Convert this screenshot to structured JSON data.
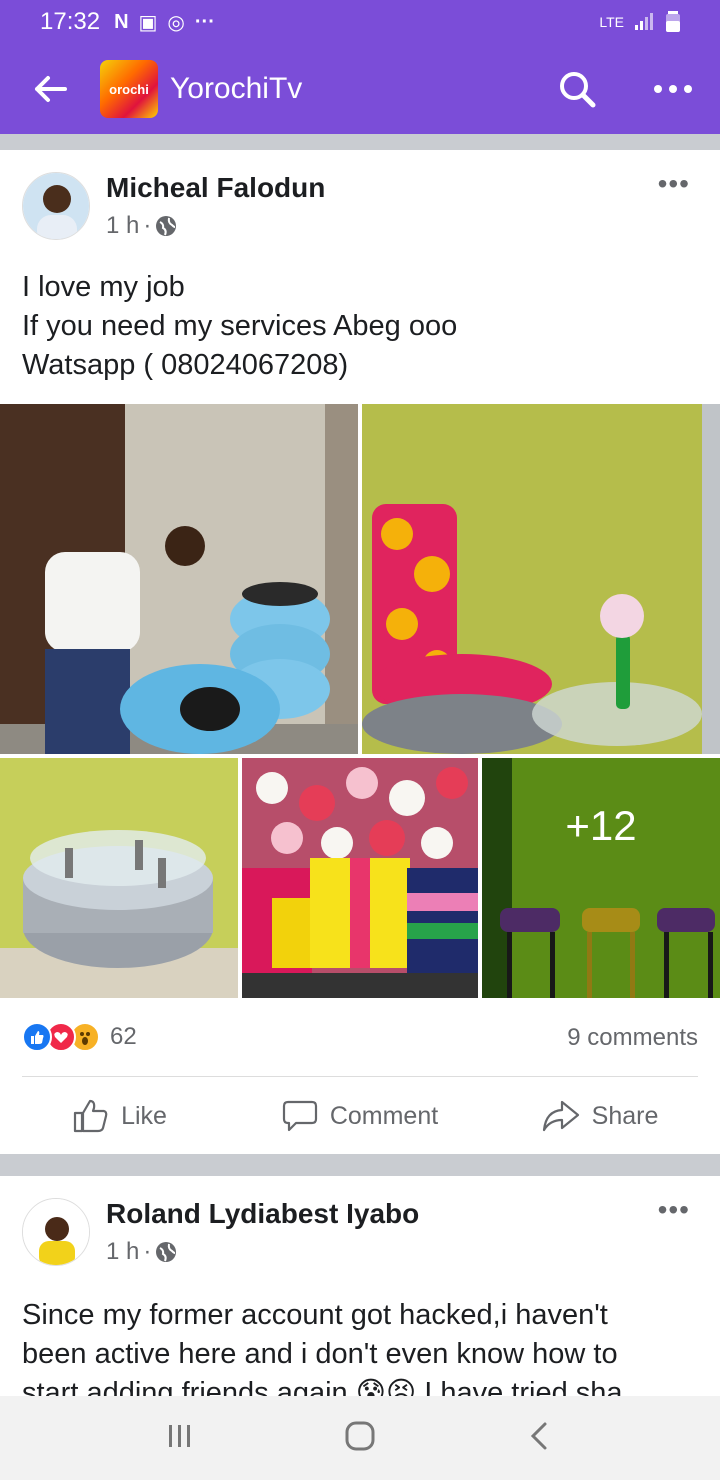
{
  "status_bar": {
    "time": "17:32",
    "icons": [
      "netflix-icon",
      "gallery-icon",
      "whatsapp-icon",
      "more-dots"
    ],
    "network": "LTE"
  },
  "app_bar": {
    "logo_text": "orochi",
    "title": "YorochiTv"
  },
  "post1": {
    "author": "Micheal Falodun",
    "time": "1 h",
    "line1": "I love my job",
    "line2": "If you need my services Abeg ooo",
    "line3": "Watsapp ( 08024067208)",
    "more_photos": "+12",
    "reaction_count": "62",
    "comments": "9 comments",
    "actions": {
      "like": "Like",
      "comment": "Comment",
      "share": "Share"
    }
  },
  "post2": {
    "author": "Roland Lydiabest Iyabo",
    "time": "1 h",
    "line1": "Since my former account got hacked,i haven't",
    "line2": "been active here and  i don't even know how to",
    "line3": "start adding friends again 😰😣   I have tried sha"
  },
  "colors": {
    "brand": "#7b4dd8",
    "like_blue": "#1877f2",
    "love_red": "#f02849"
  }
}
